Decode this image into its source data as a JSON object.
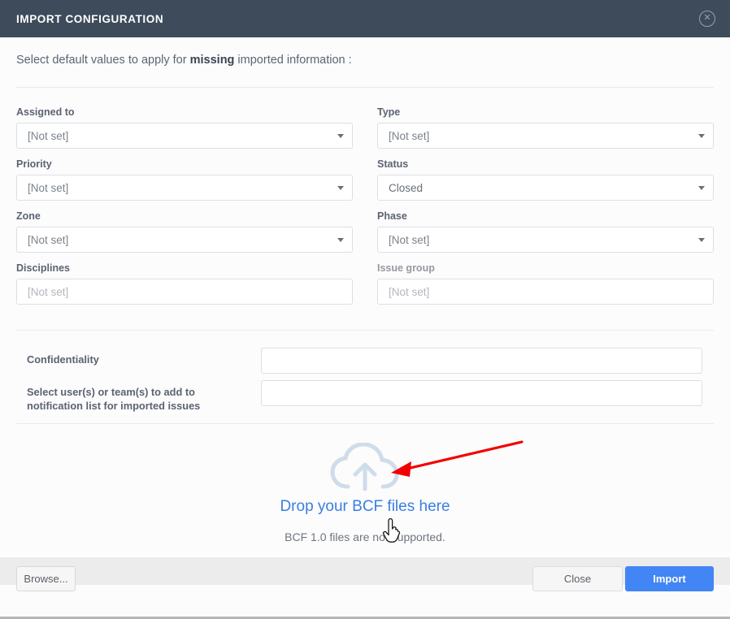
{
  "window": {
    "title": "IMPORT CONFIGURATION",
    "close_icon": "close-circle-icon",
    "header_bg": "#3e4b5b"
  },
  "intro": {
    "before": "Select default values to apply for ",
    "emphasis": "missing",
    "after": " imported information :"
  },
  "form": {
    "left": [
      {
        "label": "Assigned to",
        "value": "[Not set]",
        "type": "select",
        "caret": "chevron-down-icon"
      },
      {
        "label": "Priority",
        "value": "[Not set]",
        "type": "select",
        "caret": "chevron-down-icon"
      },
      {
        "label": "Zone",
        "value": "[Not set]",
        "type": "select",
        "caret": "chevron-down-icon"
      },
      {
        "label": "Disciplines",
        "value": "[Not set]",
        "type": "input",
        "caret": ""
      }
    ],
    "right": [
      {
        "label": "Type",
        "value": "[Not set]",
        "type": "select",
        "caret": "chevron-down-icon"
      },
      {
        "label": "Status",
        "value": "Closed",
        "type": "select",
        "caret": "chevron-down-icon"
      },
      {
        "label": "Phase",
        "value": "[Not set]",
        "type": "select",
        "caret": "chevron-down-icon"
      },
      {
        "label": "Issue group",
        "value": "[Not set]",
        "type": "input",
        "caret": ""
      }
    ]
  },
  "confidentiality": {
    "label": "Confidentiality",
    "value": "",
    "notification_label_line1": "Select user(s) or team(s) to add to",
    "notification_label_line2": "notification list for imported issues",
    "notification_value": ""
  },
  "dropzone": {
    "icon": "cloud-upload-icon",
    "link_text": "Drop your BCF files here",
    "note": "BCF 1.0 files are not supported.",
    "link_color": "#3b7fe0"
  },
  "annotation": {
    "arrow_color": "#f20000",
    "cursor": "pointer-hand-cursor"
  },
  "footer": {
    "browse_label": "Browse...",
    "close_label": "Close",
    "import_label": "Import",
    "import_color": "#4285f4"
  }
}
